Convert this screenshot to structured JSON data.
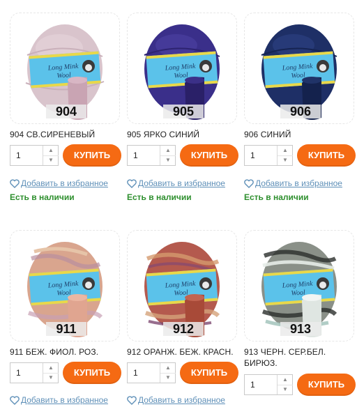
{
  "labels": {
    "buy": "КУПИТЬ",
    "favorite": "Добавить в избранное",
    "in_stock": "Есть в наличии",
    "brand_line1": "Long Mink",
    "brand_line2": "Wool"
  },
  "colors": {
    "buy_button": "#f56a13",
    "favorite_link": "#5f90b8",
    "in_stock_text": "#2e8f2e"
  },
  "products": [
    {
      "code": "904",
      "title": "904 СВ.СИРЕНЕВЫЙ",
      "qty": "1"
    },
    {
      "code": "905",
      "title": "905 ЯРКО СИНИЙ",
      "qty": "1"
    },
    {
      "code": "906",
      "title": "906 СИНИЙ",
      "qty": "1"
    },
    {
      "code": "911",
      "title": "911 БЕЖ. ФИОЛ. РОЗ.",
      "qty": "1"
    },
    {
      "code": "912",
      "title": "912 ОРАНЖ. БЕЖ. КРАСН.",
      "qty": "1"
    },
    {
      "code": "913",
      "title": "913 ЧЕРН. СЕР.БЕЛ. БИРЮЗ.",
      "qty": "1"
    }
  ]
}
